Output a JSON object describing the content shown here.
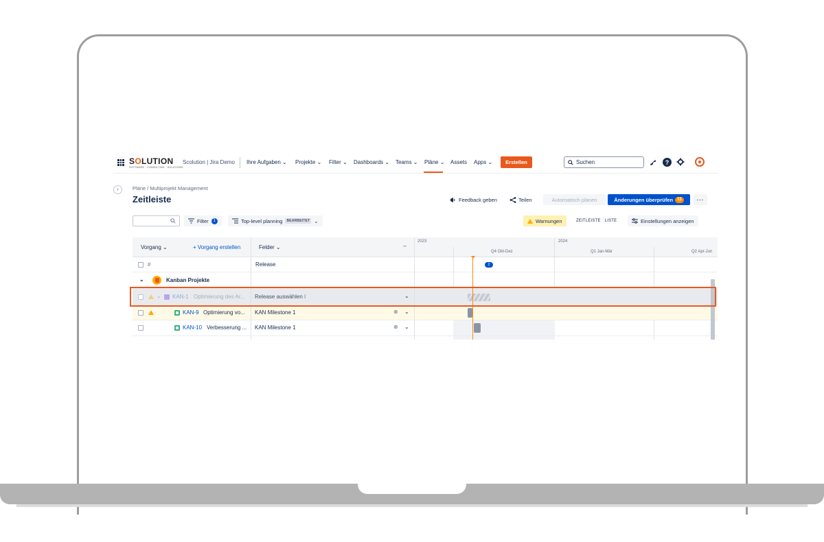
{
  "brand": {
    "logo_pre": "S",
    "logo_o": "O",
    "logo_post": "LUTION",
    "logo_sub": "SOFTWARE · CONSULTING · SOLUTIONS",
    "accent": "#e8591e",
    "primary": "#0052cc"
  },
  "nav": {
    "site_name": "Scolution | Jira Demo",
    "items": [
      "Ihre Aufgaben",
      "Projekte",
      "Filter",
      "Dashboards",
      "Teams",
      "Pläne",
      "Assets",
      "Apps"
    ],
    "create_label": "Erstellen",
    "search_placeholder": "Suchen"
  },
  "page": {
    "breadcrumb": "Pläne / Multiprojekt Management",
    "title": "Zeitleiste",
    "feedback_label": "Feedback geben",
    "share_label": "Teilen",
    "auto_plan_label": "Automatisch planen",
    "review_label": "Änderungen überprüfen",
    "review_count": "13"
  },
  "toolbar": {
    "filter_label": "Filter",
    "filter_count": "1",
    "hierarchy_label": "Top-level planning",
    "edited_badge": "BEARBEITET",
    "warnings_label": "Warnungen",
    "view_timeline": "ZEITLEISTE",
    "view_list": "LISTE",
    "settings_label": "Einstellungen anzeigen"
  },
  "table": {
    "col_issue": "Vorgang",
    "create_issue": "Vorgang erstellen",
    "col_fields": "Felder",
    "years": [
      "2023",
      "2024"
    ],
    "quarters": [
      "Q4 Okt-Dez",
      "Q1 Jan-Mär",
      "Q2 Apr-Jun"
    ],
    "hash_label": "#",
    "release_header": "Release",
    "release_count": "2",
    "group_name": "Kanban Projekte",
    "rows": [
      {
        "key": "KAN-1",
        "summary": "Optimierung des Ar...",
        "release": "Release auswählen"
      },
      {
        "key": "KAN-9",
        "summary": "Optimierung vo...",
        "release": "KAN Milestone 1"
      },
      {
        "key": "KAN-10",
        "summary": "Verbesserung ...",
        "release": "KAN Milestone 1"
      }
    ]
  }
}
